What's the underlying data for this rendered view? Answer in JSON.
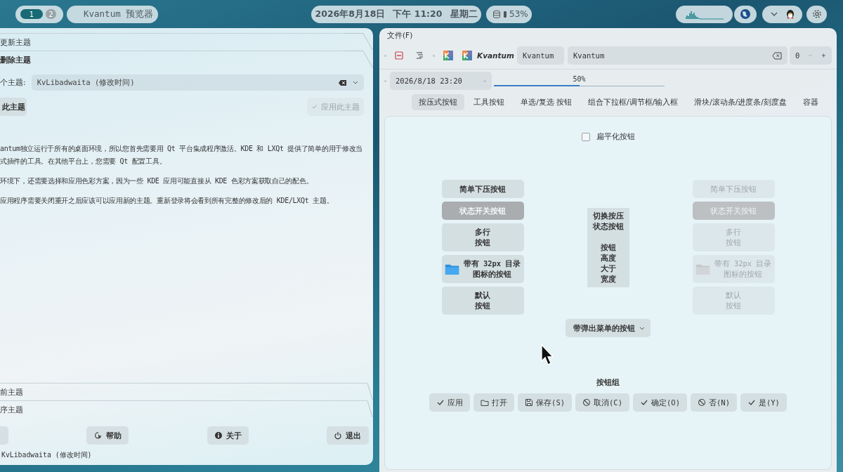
{
  "top_bar": {
    "workspaces": [
      {
        "label": "1",
        "selected": true
      },
      {
        "label": "2",
        "selected": false
      }
    ],
    "app_title": "Kvantum 预览器",
    "date": "2026年8月18日",
    "time": "下午 11:20",
    "weekday": "星期二",
    "battery": "53%"
  },
  "manager": {
    "sections_top": [
      "更新主题",
      "删除主题"
    ],
    "theme_label": "个主题:",
    "theme_combo": "KvLibadwaita (修改时间)",
    "actions": [
      {
        "label": "此主题",
        "disabled": false
      },
      {
        "label": "应用此主题",
        "disabled": true
      }
    ],
    "paragraphs": [
      [
        "antum独立运行于所有的桌面环境，所以您首先需要用 Qt 平台集成程序激活。KDE 和 LXQt 提供了简单的用于修改当",
        "式插件的工具。在其他平台上，您需要 Qt 配置工具。"
      ],
      [
        "环境下，还需要选择和应用色彩方案，因为一些 KDE 应用可能直接从 KDE 色彩方案获取自己的配色。"
      ],
      [
        "应用程序需要关闭重开之后应该可以应用新的主题。重新登录将会看到所有完整的修改后的 KDE/LXQt 主题。"
      ]
    ],
    "sections_bottom": [
      "前主题",
      "序主题"
    ],
    "buttons": [
      {
        "kind": "blank"
      },
      {
        "kind": "help",
        "label": "帮助"
      },
      {
        "kind": "about",
        "label": "关于"
      },
      {
        "kind": "quit",
        "label": "退出"
      }
    ],
    "status": "KvLibadwaita (修改时间)"
  },
  "preview": {
    "menu": "文件(F)",
    "toolbar": {
      "label": "Kvantum",
      "combo": "Kvantum",
      "line_edit": "Kvantum",
      "spin": "0"
    },
    "datetime": "2026/8/18 23:20",
    "progress": {
      "level": 0.5,
      "text": "50%"
    },
    "tabs": [
      {
        "label": "按压式按钮",
        "selected": true
      },
      {
        "label": "工具按钮",
        "selected": false
      },
      {
        "label": "单选/复选 按钮",
        "selected": false
      },
      {
        "label": "组合下拉框/调节框/输入框",
        "selected": false
      },
      {
        "label": "滑块/滚动条/进度条/刻度盘",
        "selected": false
      },
      {
        "label": "容器",
        "selected": false
      }
    ],
    "flat_checkbox": {
      "label": "扁平化按钮",
      "checked": false
    },
    "columns": [
      {
        "disabled": false,
        "buttons": [
          {
            "kind": "push",
            "lines": [
              "简单下压按钮"
            ]
          },
          {
            "kind": "toggle",
            "lines": [
              "状态开关按钮"
            ],
            "checked": true
          },
          {
            "kind": "push",
            "lines": [
              "多行",
              "按钮"
            ]
          },
          {
            "kind": "folder",
            "lines": [
              "带有 32px 目录",
              "图标的按钮"
            ]
          },
          {
            "kind": "push",
            "lines": [
              "默认",
              "按钮"
            ]
          }
        ]
      },
      {
        "disabled": true,
        "buttons": [
          {
            "kind": "push",
            "lines": [
              "简单下压按钮"
            ]
          },
          {
            "kind": "toggle",
            "lines": [
              "状态开关按钮"
            ],
            "checked": true
          },
          {
            "kind": "push",
            "lines": [
              "多行",
              "按钮"
            ]
          },
          {
            "kind": "folder",
            "lines": [
              "带有 32px 目录",
              "图标的按钮"
            ]
          },
          {
            "kind": "push",
            "lines": [
              "默认",
              "按钮"
            ]
          }
        ]
      }
    ],
    "tall_button": [
      [
        "切换按压",
        "状态按钮"
      ],
      [
        "按钮",
        "高度",
        "大于",
        "宽度"
      ]
    ],
    "menu_button": "带弹出菜单的按钮",
    "group_title": "按钮组",
    "dialog_buttons": [
      {
        "kind": "check",
        "label": "应用"
      },
      {
        "kind": "folder",
        "label": "打开"
      },
      {
        "kind": "save",
        "label": "保存(S)"
      },
      {
        "kind": "cancel",
        "label": "取消(C)"
      },
      {
        "kind": "check",
        "label": "确定(O)"
      },
      {
        "kind": "cancel",
        "label": "否(N)"
      },
      {
        "kind": "check",
        "label": "是(Y)"
      }
    ]
  }
}
